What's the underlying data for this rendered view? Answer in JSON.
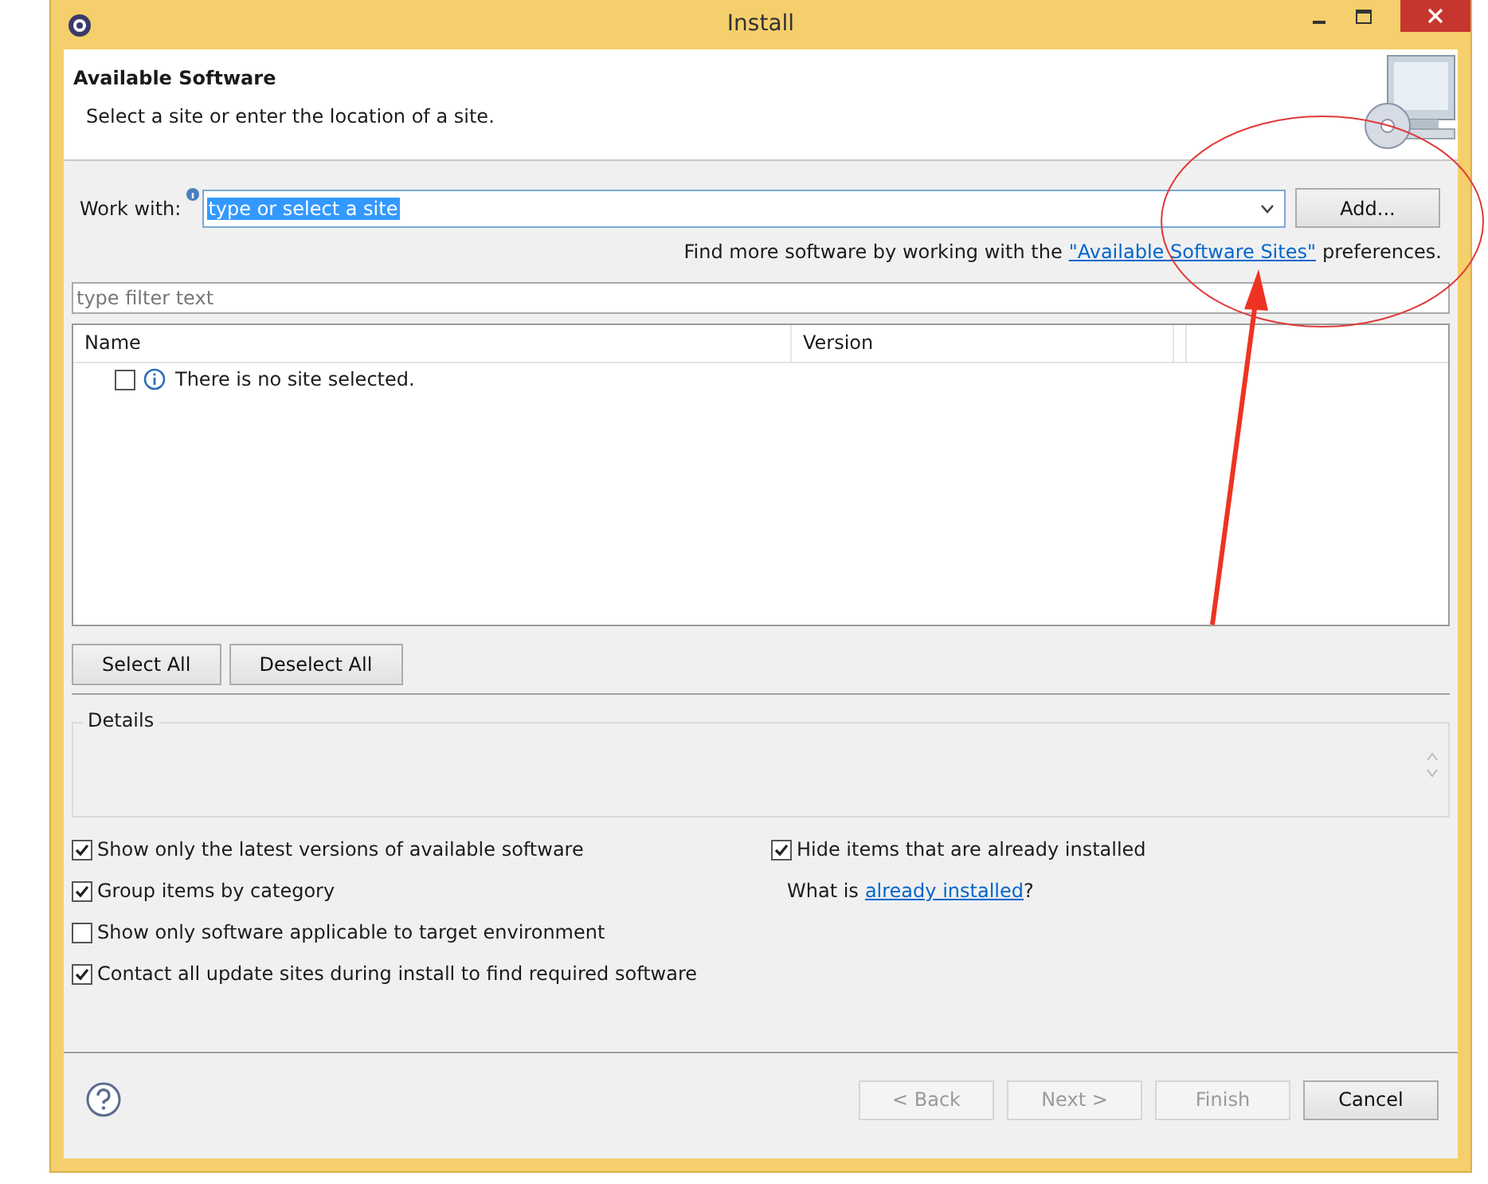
{
  "window": {
    "title": "Install"
  },
  "header": {
    "title": "Available Software",
    "description": "Select a site or enter the location of a site."
  },
  "work_with": {
    "label": "Work with:",
    "value": "type or select a site",
    "button": "Add..."
  },
  "find_more": {
    "text": "Find more software by working with the",
    "link": "\"Available Software Sites\"",
    "suffix": "preferences."
  },
  "filter": {
    "placeholder": "type filter text"
  },
  "table": {
    "columns": [
      "Name",
      "Version"
    ],
    "rows": [
      {
        "text": "There is no site selected.",
        "checked": false
      }
    ]
  },
  "selection_buttons": [
    "Select All",
    "Deselect All"
  ],
  "details": {
    "title": "Details"
  },
  "options_left": [
    {
      "label": "Show only the latest versions of available software",
      "checked": true
    },
    {
      "label": "Group items by category",
      "checked": true
    },
    {
      "label": "Show only software applicable to target environment",
      "checked": false
    },
    {
      "label": "Contact all update sites during install to find required software",
      "checked": true
    }
  ],
  "options_right": [
    {
      "label": "Hide items that are already installed",
      "checked": true
    }
  ],
  "installed_hint": {
    "text": "What is",
    "link": "already installed",
    "suffix": "?"
  },
  "footer_buttons": [
    {
      "label": "< Back",
      "disabled": true
    },
    {
      "label": "Next >",
      "disabled": true
    },
    {
      "label": "Finish",
      "disabled": true
    },
    {
      "label": "Cancel",
      "disabled": false
    }
  ]
}
